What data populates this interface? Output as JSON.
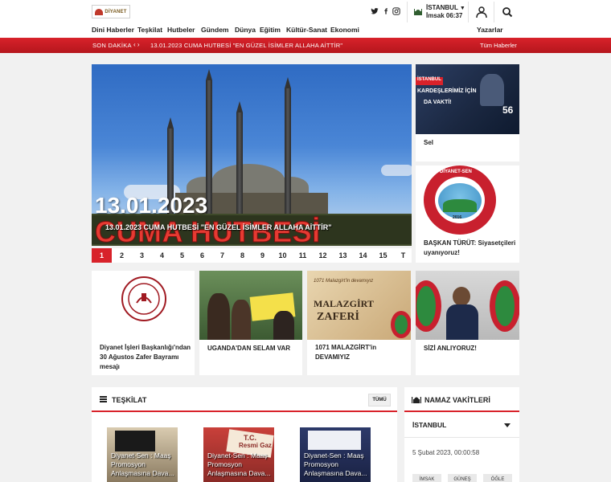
{
  "header": {
    "logo_text": "DİYANET",
    "city": "İSTANBUL",
    "imsak": "İmsak 06:37",
    "social": [
      "twitter-icon",
      "facebook-icon",
      "instagram-icon"
    ]
  },
  "nav": {
    "items": [
      "Dini Haberler",
      "Teşkilat",
      "Hutbeler",
      "Gündem",
      "Dünya",
      "Eğitim",
      "Kültür-Sanat",
      "Ekonomi"
    ],
    "right_link": "Yazarlar"
  },
  "ticker": {
    "label": "SON DAKİKA",
    "headline": "13.01.2023 CUMA HUTBESİ \"EN GÜZEL İSİMLER ALLAHA AİTTİR\"",
    "all_link": "Tüm Haberler"
  },
  "slider": {
    "overlay_date": "13.01.2023",
    "overlay_title": "CUMA HUTBESİ",
    "caption": "13.01.2023 CUMA HUTBESİ \"EN GÜZEL İSİMLER ALLAHA AİTTİR\"",
    "pages": [
      "1",
      "2",
      "3",
      "4",
      "5",
      "6",
      "7",
      "8",
      "9",
      "10",
      "11",
      "12",
      "13",
      "14",
      "15",
      "T"
    ],
    "active_page": "1"
  },
  "side_cards": [
    {
      "title": "Sel",
      "img_text_1": "İSTANBUL",
      "img_text_2": "KARDEŞLERİMİZ İÇİN",
      "img_text_3": "DA VAKTİ!",
      "img_text_4": "56"
    },
    {
      "title": "BAŞKAN TÜRÜT: Siyasetçileri uyanıyoruz!",
      "img_text_1": "DİYANET-SEN",
      "img_text_2": "2016"
    }
  ],
  "news_cards": [
    {
      "title": "Diyanet İşleri Başkanlığı'ndan 30 Ağustos Zafer Bayramı mesajı"
    },
    {
      "title": "UGANDA'DAN SELAM VAR"
    },
    {
      "title": "1071 MALAZGİRT'in DEVAMIYIZ",
      "img_text_1": "1071 Malazgirt'in devamıyız",
      "img_text_2": "MALAZGİRT",
      "img_text_3": "ZAFERİ"
    },
    {
      "title": "SİZİ ANLIYORUZ!"
    }
  ],
  "teskilat": {
    "heading": "TEŞKİLAT",
    "all_button": "TÜMÜ",
    "items": [
      {
        "caption": "Diyanet-Sen : Maaş Promosyon Anlaşmasına Dava..."
      },
      {
        "caption": "Diyanet-Sen : Maaş Promosyon Anlaşmasına Dava...",
        "img_text_1": "T.C.",
        "img_text_2": "Resmi Gaz"
      },
      {
        "caption": "Diyanet-Sen : Maaş Promosyon Anlaşmasına Dava..."
      }
    ]
  },
  "namaz": {
    "heading": "NAMAZ VAKİTLERİ",
    "city": "İSTANBUL",
    "date": "5 Şubat 2023, 00:00:58",
    "tabs": [
      "İMSAK",
      "GÜNEŞ",
      "ÖĞLE"
    ]
  },
  "colors": {
    "accent": "#d8222a",
    "background": "#f1f1f1"
  }
}
